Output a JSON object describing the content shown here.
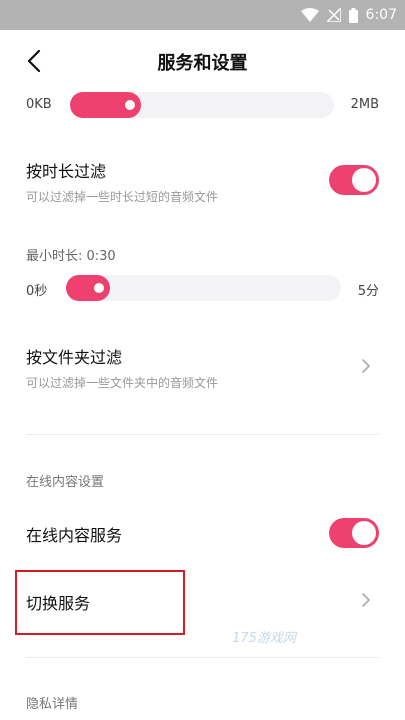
{
  "status": {
    "time": "6:07"
  },
  "header": {
    "title": "服务和设置"
  },
  "size_slider": {
    "min_label": "0KB",
    "max_label": "2MB",
    "fill_fraction": 0.27
  },
  "duration_filter": {
    "title": "按时长过滤",
    "subtitle": "可以过滤掉一些时长过短的音频文件",
    "enabled": true,
    "min_duration_label": "最小时长: 0:30",
    "slider": {
      "min_label": "0秒",
      "max_label": "5分",
      "fill_fraction": 0.16
    }
  },
  "folder_filter": {
    "title": "按文件夹过滤",
    "subtitle": "可以过滤掉一些文件夹中的音频文件"
  },
  "online_section": {
    "label": "在线内容设置"
  },
  "online_service": {
    "title": "在线内容服务",
    "enabled": true
  },
  "switch_service": {
    "title": "切换服务"
  },
  "privacy_section": {
    "label": "隐私详情"
  },
  "watermark": {
    "text": "175游戏网"
  },
  "colors": {
    "accent": "#ee4170",
    "highlight_border": "#d21e28"
  },
  "icons": {
    "back": "back-arrow-icon",
    "chevron": "chevron-right-icon",
    "wifi": "wifi-icon",
    "signal": "signal-icon",
    "battery": "battery-icon"
  }
}
